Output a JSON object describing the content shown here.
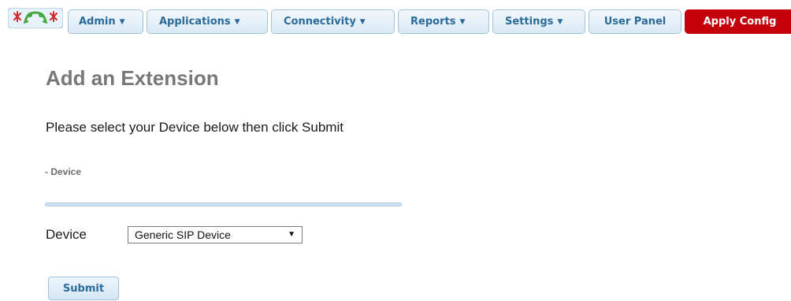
{
  "nav": {
    "logo_icon": "freepbx-frog-logo-icon",
    "items": [
      {
        "label": "Admin",
        "dropdown": true
      },
      {
        "label": "Applications",
        "dropdown": true
      },
      {
        "label": "Connectivity",
        "dropdown": true
      },
      {
        "label": "Reports",
        "dropdown": true
      },
      {
        "label": "Settings",
        "dropdown": true
      },
      {
        "label": "User Panel",
        "dropdown": false
      }
    ],
    "apply_label": "Apply Config",
    "apply_color": "#c4000b"
  },
  "page": {
    "title": "Add an Extension",
    "instructions": "Please select your Device below then click Submit",
    "section_label": "- Device"
  },
  "form": {
    "device_label": "Device",
    "device_value": "Generic SIP Device",
    "submit_label": "Submit"
  },
  "icons": {
    "caret": "▼"
  }
}
